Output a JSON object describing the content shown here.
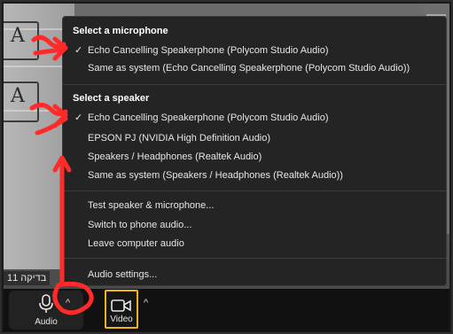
{
  "menu": {
    "microphone_header": "Select a microphone",
    "microphone_items": [
      {
        "label": "Echo Cancelling Speakerphone (Polycom Studio Audio)",
        "checked": true
      },
      {
        "label": "Same as system (Echo Cancelling Speakerphone (Polycom Studio Audio))",
        "checked": false
      }
    ],
    "speaker_header": "Select a speaker",
    "speaker_items": [
      {
        "label": "Echo Cancelling Speakerphone (Polycom Studio Audio)",
        "checked": true
      },
      {
        "label": "EPSON PJ (NVIDIA High Definition Audio)",
        "checked": false
      },
      {
        "label": "Speakers / Headphones (Realtek Audio)",
        "checked": false
      },
      {
        "label": "Same as system (Speakers / Headphones (Realtek Audio))",
        "checked": false
      }
    ],
    "actions": [
      {
        "label": "Test speaker & microphone..."
      },
      {
        "label": "Switch to phone audio..."
      },
      {
        "label": "Leave computer audio"
      }
    ],
    "settings": {
      "label": "Audio settings..."
    },
    "check_glyph": "✓"
  },
  "participant": {
    "name": "בדיקה 11"
  },
  "toolbar": {
    "audio_label": "Audio",
    "video_label": "Video",
    "caret_glyph": "^"
  },
  "colors": {
    "menu_bg": "#242424",
    "highlight": "#f0b323",
    "annotation": "#ff2a2a"
  },
  "icons": [
    "microphone-icon",
    "video-camera-icon",
    "checkmark-icon",
    "caret-up-icon"
  ]
}
